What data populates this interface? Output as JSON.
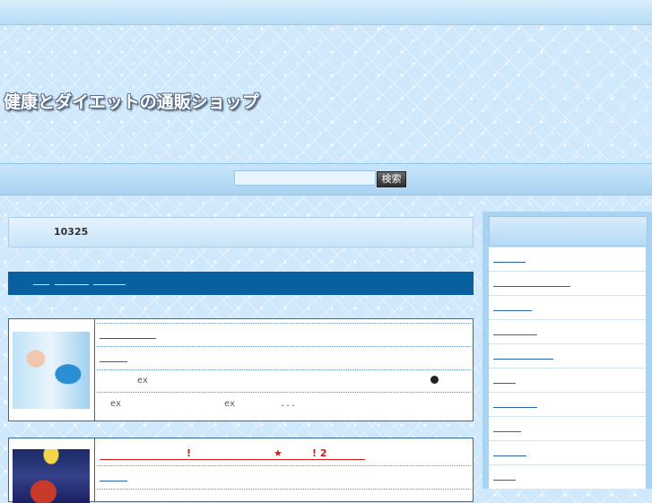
{
  "header": {
    "title": "健康とダイエットの通販ショップ"
  },
  "search": {
    "placeholder": "",
    "button_label": "検索"
  },
  "results": {
    "count": "10325"
  },
  "products": [
    {
      "badge": "ex",
      "desc_chars": [
        "ex",
        "ex",
        "..."
      ]
    },
    {
      "marks": [
        "!",
        "★",
        "! 2"
      ]
    }
  ],
  "colors": {
    "nav_bar": "#08609e",
    "link_red": "#d21a1a",
    "link_blue": "#2a63b0",
    "border": "#2f6d98"
  },
  "icons": [
    "bullet-icon",
    "star-icon"
  ]
}
